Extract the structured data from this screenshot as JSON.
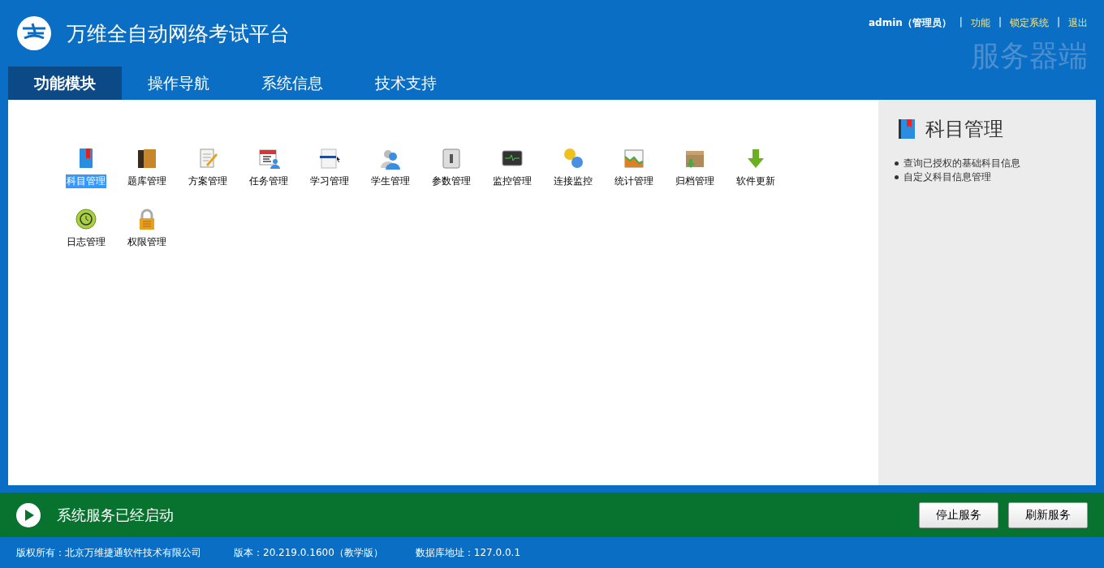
{
  "header": {
    "title": "万维全自动网络考试平台",
    "user": "admin（管理员）",
    "separator": "|",
    "links": [
      "功能",
      "锁定系统",
      "退出"
    ],
    "mode": "服务器端"
  },
  "tabs": [
    {
      "label": "功能模块",
      "selected": true
    },
    {
      "label": "操作导航",
      "selected": false
    },
    {
      "label": "系统信息",
      "selected": false
    },
    {
      "label": "技术支持",
      "selected": false
    }
  ],
  "modules": [
    {
      "label": "科目管理",
      "selected": true
    },
    {
      "label": "题库管理",
      "selected": false
    },
    {
      "label": "方案管理",
      "selected": false
    },
    {
      "label": "任务管理",
      "selected": false
    },
    {
      "label": "学习管理",
      "selected": false
    },
    {
      "label": "学生管理",
      "selected": false
    },
    {
      "label": "参数管理",
      "selected": false
    },
    {
      "label": "监控管理",
      "selected": false
    },
    {
      "label": "连接监控",
      "selected": false
    },
    {
      "label": "统计管理",
      "selected": false
    },
    {
      "label": "归档管理",
      "selected": false
    },
    {
      "label": "软件更新",
      "selected": false
    },
    {
      "label": "日志管理",
      "selected": false
    },
    {
      "label": "权限管理",
      "selected": false
    }
  ],
  "side_panel": {
    "title": "科目管理",
    "items": [
      "查询已授权的基础科目信息",
      "自定义科目信息管理"
    ]
  },
  "status_bar": {
    "message": "系统服务已经启动",
    "buttons": [
      "停止服务",
      "刷新服务"
    ]
  },
  "footer": [
    "版权所有：北京万维捷通软件技术有限公司",
    "版本：20.219.0.1600（教学版）",
    "数据库地址：127.0.0.1"
  ]
}
